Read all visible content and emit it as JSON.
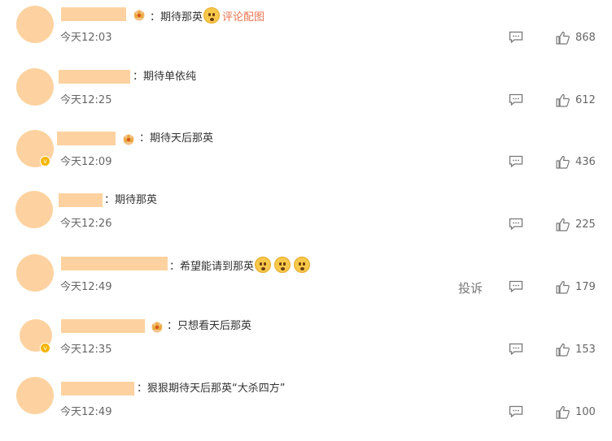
{
  "comments": [
    {
      "colon": "：",
      "text": "期待那英",
      "link": "评论配图",
      "time": "今天12:03",
      "likes": "868"
    },
    {
      "colon": "：",
      "text": "期待单依纯",
      "time": "今天12:25",
      "likes": "612"
    },
    {
      "colon": "：",
      "text": "期待天后那英",
      "time": "今天12:09",
      "likes": "436"
    },
    {
      "colon": "：",
      "text": "期待那英",
      "time": "今天12:26",
      "likes": "225"
    },
    {
      "colon": "：",
      "text": "希望能请到那英",
      "time": "今天12:49",
      "likes": "179",
      "report": "投诉"
    },
    {
      "colon": "：",
      "text": "只想看天后那英",
      "time": "今天12:35",
      "likes": "153"
    },
    {
      "colon": "：",
      "text": "狠狠期待天后那英“大杀四方”",
      "time": "今天12:49",
      "likes": "100"
    }
  ],
  "icons": {
    "comment": "comment-icon",
    "like": "thumbs-up-icon",
    "crown": "crown-badge-icon",
    "verified": "verified-badge-icon",
    "emoji": "blushing-face-emoji"
  },
  "colors": {
    "placeholder": "#fdd2a0",
    "link": "#eb7350",
    "text": "#333333",
    "meta": "#666666"
  }
}
